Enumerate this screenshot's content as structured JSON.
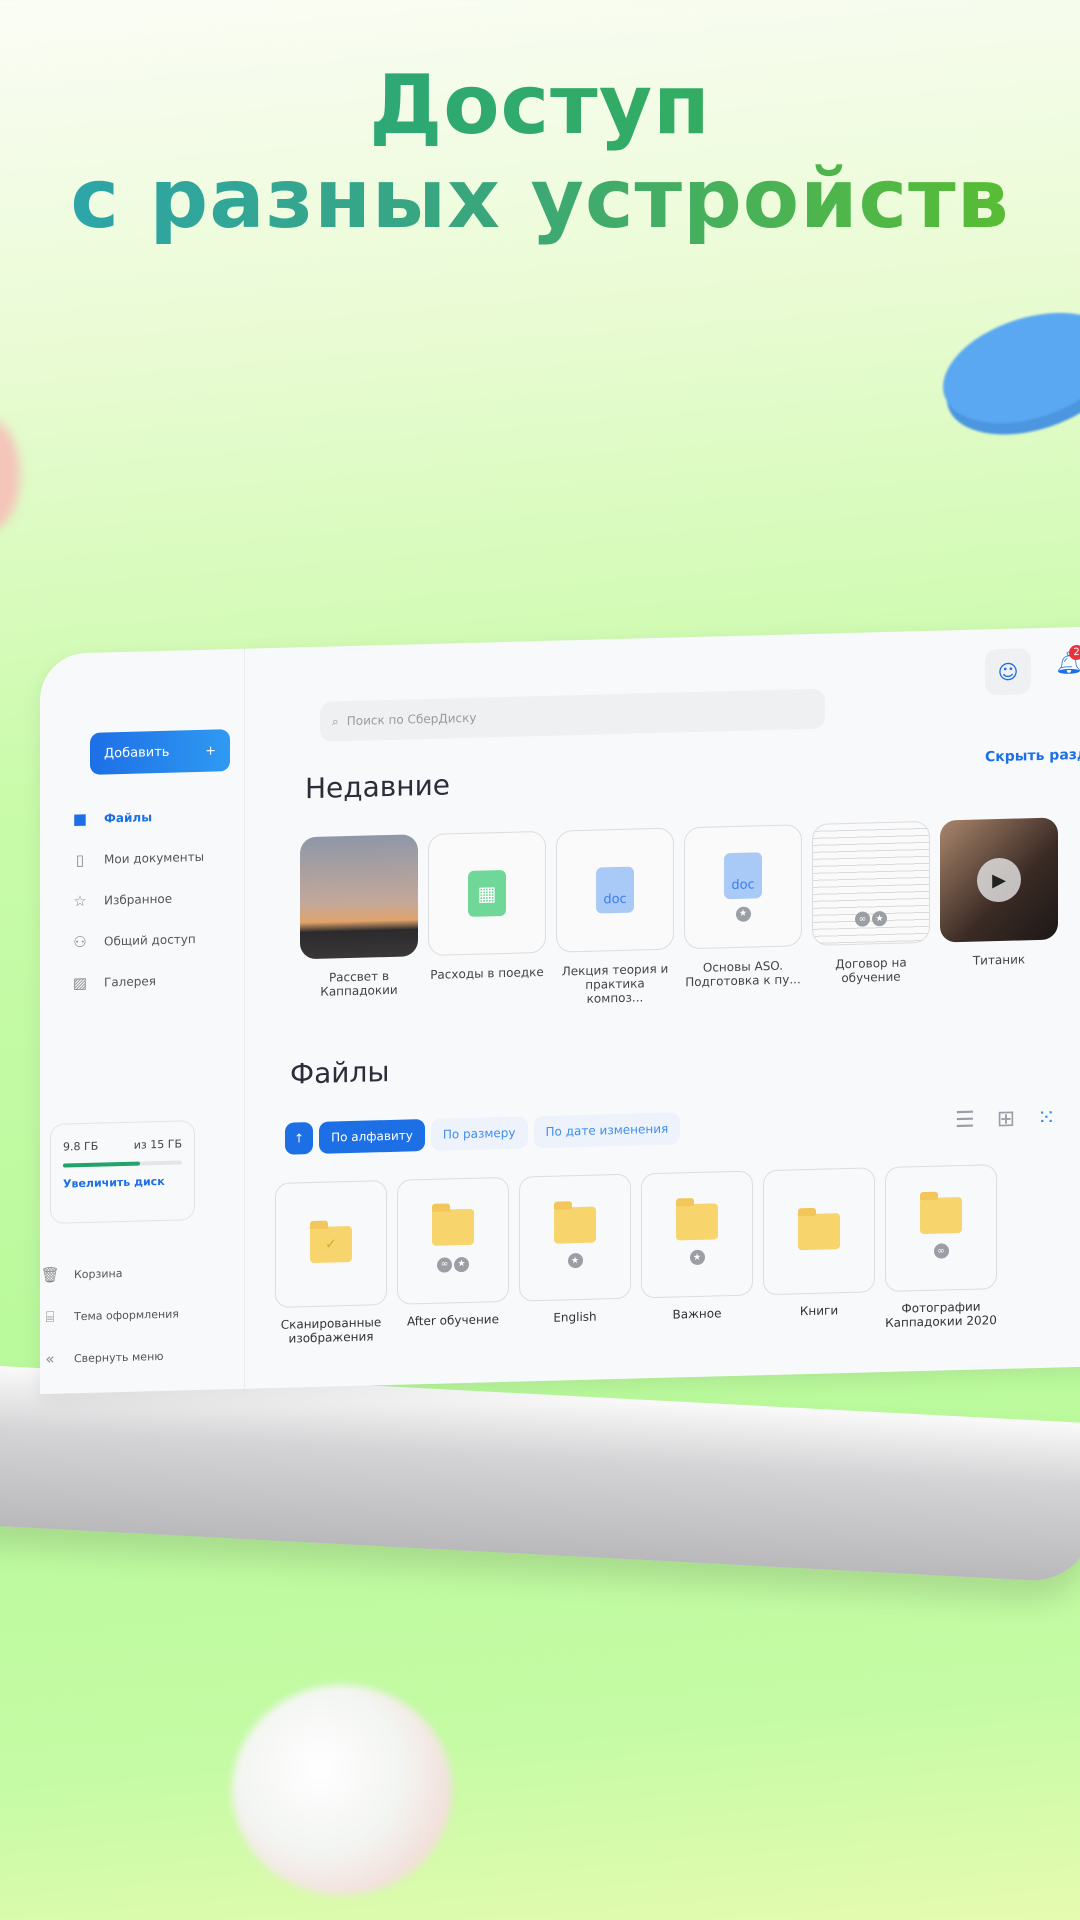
{
  "headline": {
    "line1": "Доступ",
    "line2": "с разных устройств"
  },
  "colors": {
    "accent": "#1d6fe6",
    "storage_bar": "#21a36b",
    "folder": "#f8d46d",
    "badge": "#e8323c"
  },
  "sidebar": {
    "add_label": "Добавить",
    "items": [
      {
        "label": "Файлы",
        "icon": "folder-icon"
      },
      {
        "label": "Мои документы",
        "icon": "id-card-icon"
      },
      {
        "label": "Избранное",
        "icon": "star-icon"
      },
      {
        "label": "Общий доступ",
        "icon": "users-icon"
      },
      {
        "label": "Галерея",
        "icon": "image-icon"
      }
    ],
    "storage": {
      "used": "9.8 ГБ",
      "total": "из 15 ГБ",
      "used_fraction": 0.65,
      "increase_label": "Увеличить диск"
    },
    "bottom": [
      {
        "label": "Корзина",
        "icon": "trash-icon"
      },
      {
        "label": "Тема оформления",
        "icon": "paint-brush-icon"
      },
      {
        "label": "Свернуть меню",
        "icon": "double-chevron-left-icon"
      }
    ]
  },
  "header": {
    "search_placeholder": "Поиск по СберДиску",
    "notifications": "2"
  },
  "recent": {
    "title": "Недавние",
    "hide_label": "Скрыть раздел",
    "items": [
      {
        "name": "Рассвет в Каппадокии",
        "type": "photo"
      },
      {
        "name": "Расходы в поедке",
        "type": "sheet"
      },
      {
        "name": "Лекция теория и практика композ...",
        "type": "doc",
        "doc_label": "doc"
      },
      {
        "name": "Основы ASO. Подготовка к пу...",
        "type": "doc",
        "doc_label": "doc"
      },
      {
        "name": "Договор на обучение",
        "type": "scan"
      },
      {
        "name": "Титаник",
        "type": "video"
      }
    ]
  },
  "files": {
    "title": "Файлы",
    "sort": [
      "По алфавиту",
      "По размеру",
      "По дате изменения"
    ],
    "active_sort": "По алфавиту",
    "folders": [
      {
        "name": "Сканированные изображения"
      },
      {
        "name": "After обучение"
      },
      {
        "name": "English"
      },
      {
        "name": "Важное"
      },
      {
        "name": "Книги"
      },
      {
        "name": "Фотографии Каппадокии 2020"
      }
    ]
  }
}
